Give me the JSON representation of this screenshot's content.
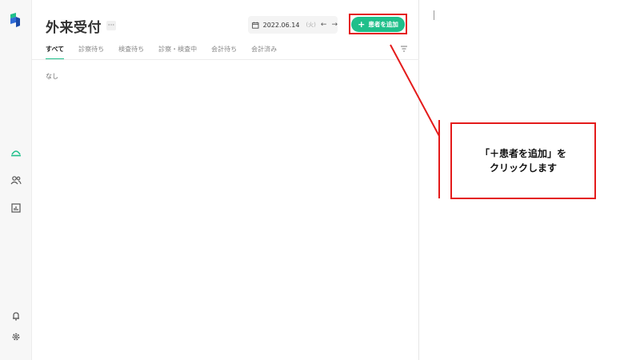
{
  "header": {
    "title": "外来受付",
    "more_label": "···",
    "date": "2022.06.14",
    "day_of_week": "(火)",
    "prev_arrow": "←",
    "next_arrow": "→",
    "add_button_plus": "+",
    "add_button_label": "患者を追加"
  },
  "tabs": [
    {
      "label": "すべて",
      "active": true
    },
    {
      "label": "診察待ち",
      "active": false
    },
    {
      "label": "検査待ち",
      "active": false
    },
    {
      "label": "診察・検査中",
      "active": false
    },
    {
      "label": "会計待ち",
      "active": false
    },
    {
      "label": "会計済み",
      "active": false
    }
  ],
  "main": {
    "empty_text": "なし"
  },
  "annotation": {
    "line1": "「＋患者を追加」を",
    "line2": "クリックします"
  },
  "colors": {
    "accent": "#1fbf8a",
    "annotation_red": "#e41b1b"
  },
  "icons": {
    "rail_top": [
      "logo-icon"
    ],
    "rail_middle": [
      "reception-icon",
      "patients-icon",
      "reports-icon"
    ],
    "rail_bottom": [
      "bell-icon",
      "settings-icon"
    ]
  }
}
